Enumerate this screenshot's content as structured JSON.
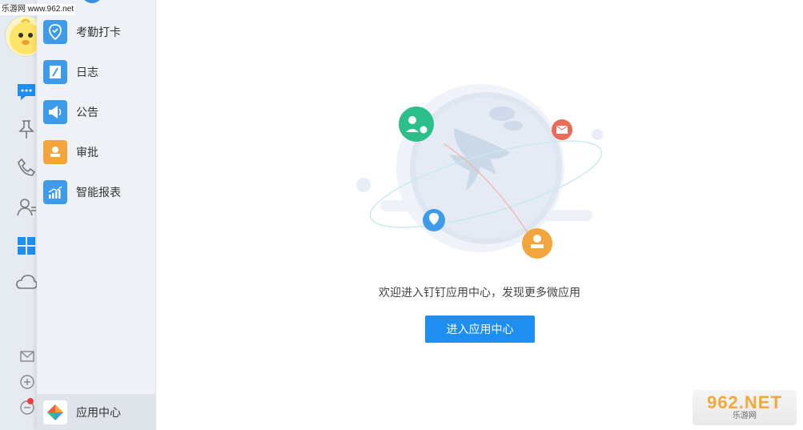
{
  "watermark": {
    "top_left": "乐游网 www.962.net",
    "bottom_right_brand": "962.NET",
    "bottom_right_sub": "乐游网"
  },
  "rail": {
    "icons": [
      "chat-icon",
      "pin-icon",
      "phone-icon",
      "contacts-icon",
      "apps-grid-icon",
      "cloud-icon",
      "mail-icon",
      "add-icon",
      "more-icon"
    ]
  },
  "menu": {
    "items": [
      {
        "label": "考勤打卡",
        "icon": "location-check-icon",
        "color": "#3e9bea"
      },
      {
        "label": "日志",
        "icon": "notebook-icon",
        "color": "#3e9bea"
      },
      {
        "label": "公告",
        "icon": "megaphone-icon",
        "color": "#3e9bea"
      },
      {
        "label": "审批",
        "icon": "approval-stamp-icon",
        "color": "#f2a53a"
      },
      {
        "label": "智能报表",
        "icon": "report-chart-icon",
        "color": "#3e9bea"
      }
    ],
    "app_center": {
      "label": "应用中心",
      "icon": "app-center-logo-icon"
    }
  },
  "main": {
    "welcome_text": "欢迎进入钉钉应用中心，发现更多微应用",
    "enter_button": "进入应用中心"
  },
  "colors": {
    "primary": "#1e8ef0",
    "rail_bg": "#e6ebf2",
    "panel_bg": "#eef1f6"
  }
}
